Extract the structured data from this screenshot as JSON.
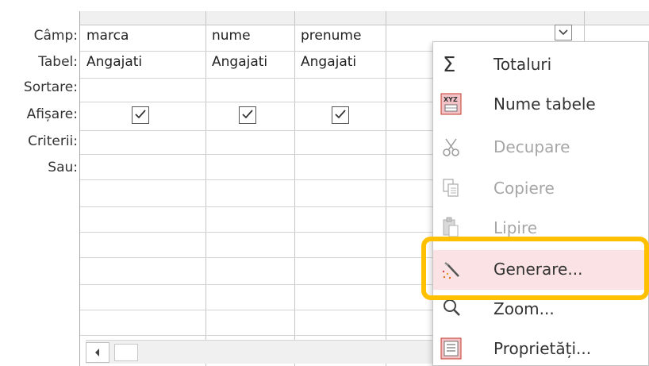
{
  "row_labels": {
    "camp": "Câmp:",
    "tabel": "Tabel:",
    "sortare": "Sortare:",
    "afisare": "Afișare:",
    "criterii": "Criterii:",
    "sau": "Sau:"
  },
  "columns": [
    {
      "field": "marca",
      "table": "Angajati",
      "show": true
    },
    {
      "field": "nume",
      "table": "Angajati",
      "show": true
    },
    {
      "field": "prenume",
      "table": "Angajati",
      "show": true
    }
  ],
  "context_menu": {
    "items": [
      {
        "label": "Totaluri",
        "icon": "sigma-icon",
        "enabled": true
      },
      {
        "label": "Nume tabele",
        "icon": "table-names-icon",
        "enabled": true
      },
      {
        "label": "Decupare",
        "icon": "scissors-icon",
        "enabled": false
      },
      {
        "label": "Copiere",
        "icon": "copy-icon",
        "enabled": false
      },
      {
        "label": "Lipire",
        "icon": "paste-icon",
        "enabled": false
      },
      {
        "label": "Generare...",
        "icon": "builder-wand-icon",
        "enabled": true,
        "highlighted": true
      },
      {
        "label": "Zoom...",
        "icon": "zoom-icon",
        "enabled": true
      },
      {
        "label": "Proprietăți...",
        "icon": "properties-icon",
        "enabled": true
      }
    ]
  },
  "colors": {
    "highlight_outline": "#ffc000",
    "hover_background": "#fbe3e5",
    "icon_red": "#e04f5f"
  }
}
